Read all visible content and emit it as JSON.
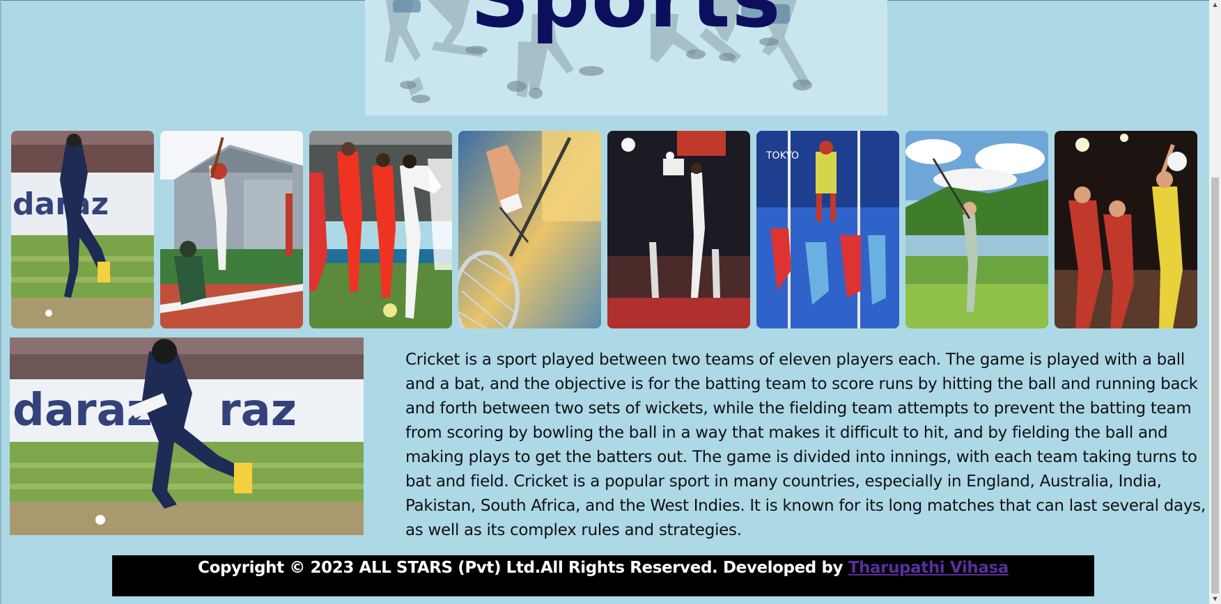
{
  "banner": {
    "title": "Sports"
  },
  "gallery": {
    "items": [
      {
        "name": "cricket-photo"
      },
      {
        "name": "baseball-photo"
      },
      {
        "name": "football-photo"
      },
      {
        "name": "badminton-photo"
      },
      {
        "name": "basketball-photo"
      },
      {
        "name": "hockey-photo"
      },
      {
        "name": "golf-photo"
      },
      {
        "name": "netball-photo"
      }
    ]
  },
  "featured": {
    "image": "cricket-photo",
    "description": "Cricket is a sport played between two teams of eleven players each. The game is played with a ball and a bat, and the objective is for the batting team to score runs by hitting the ball and running back and forth between two sets of wickets, while the fielding team attempts to prevent the batting team from scoring by bowling the ball in a way that makes it difficult to hit, and by fielding the ball and making plays to get the batters out. The game is divided into innings, with each team taking turns to bat and field. Cricket is a popular sport in many countries, especially in England, Australia, India, Pakistan, South Africa, and the West Indies. It is known for its long matches that can last several days, as well as its complex rules and strategies."
  },
  "footer": {
    "text": "Copyright © 2023 ALL STARS (Pvt) Ltd.All Rights Reserved. Developed by ",
    "developer_link": "Tharupathi Vihasa"
  },
  "colors": {
    "page_background": "#add8e6",
    "banner_title": "#0c0f5e",
    "footer_background": "#000000",
    "link": "#5a2d9c"
  }
}
